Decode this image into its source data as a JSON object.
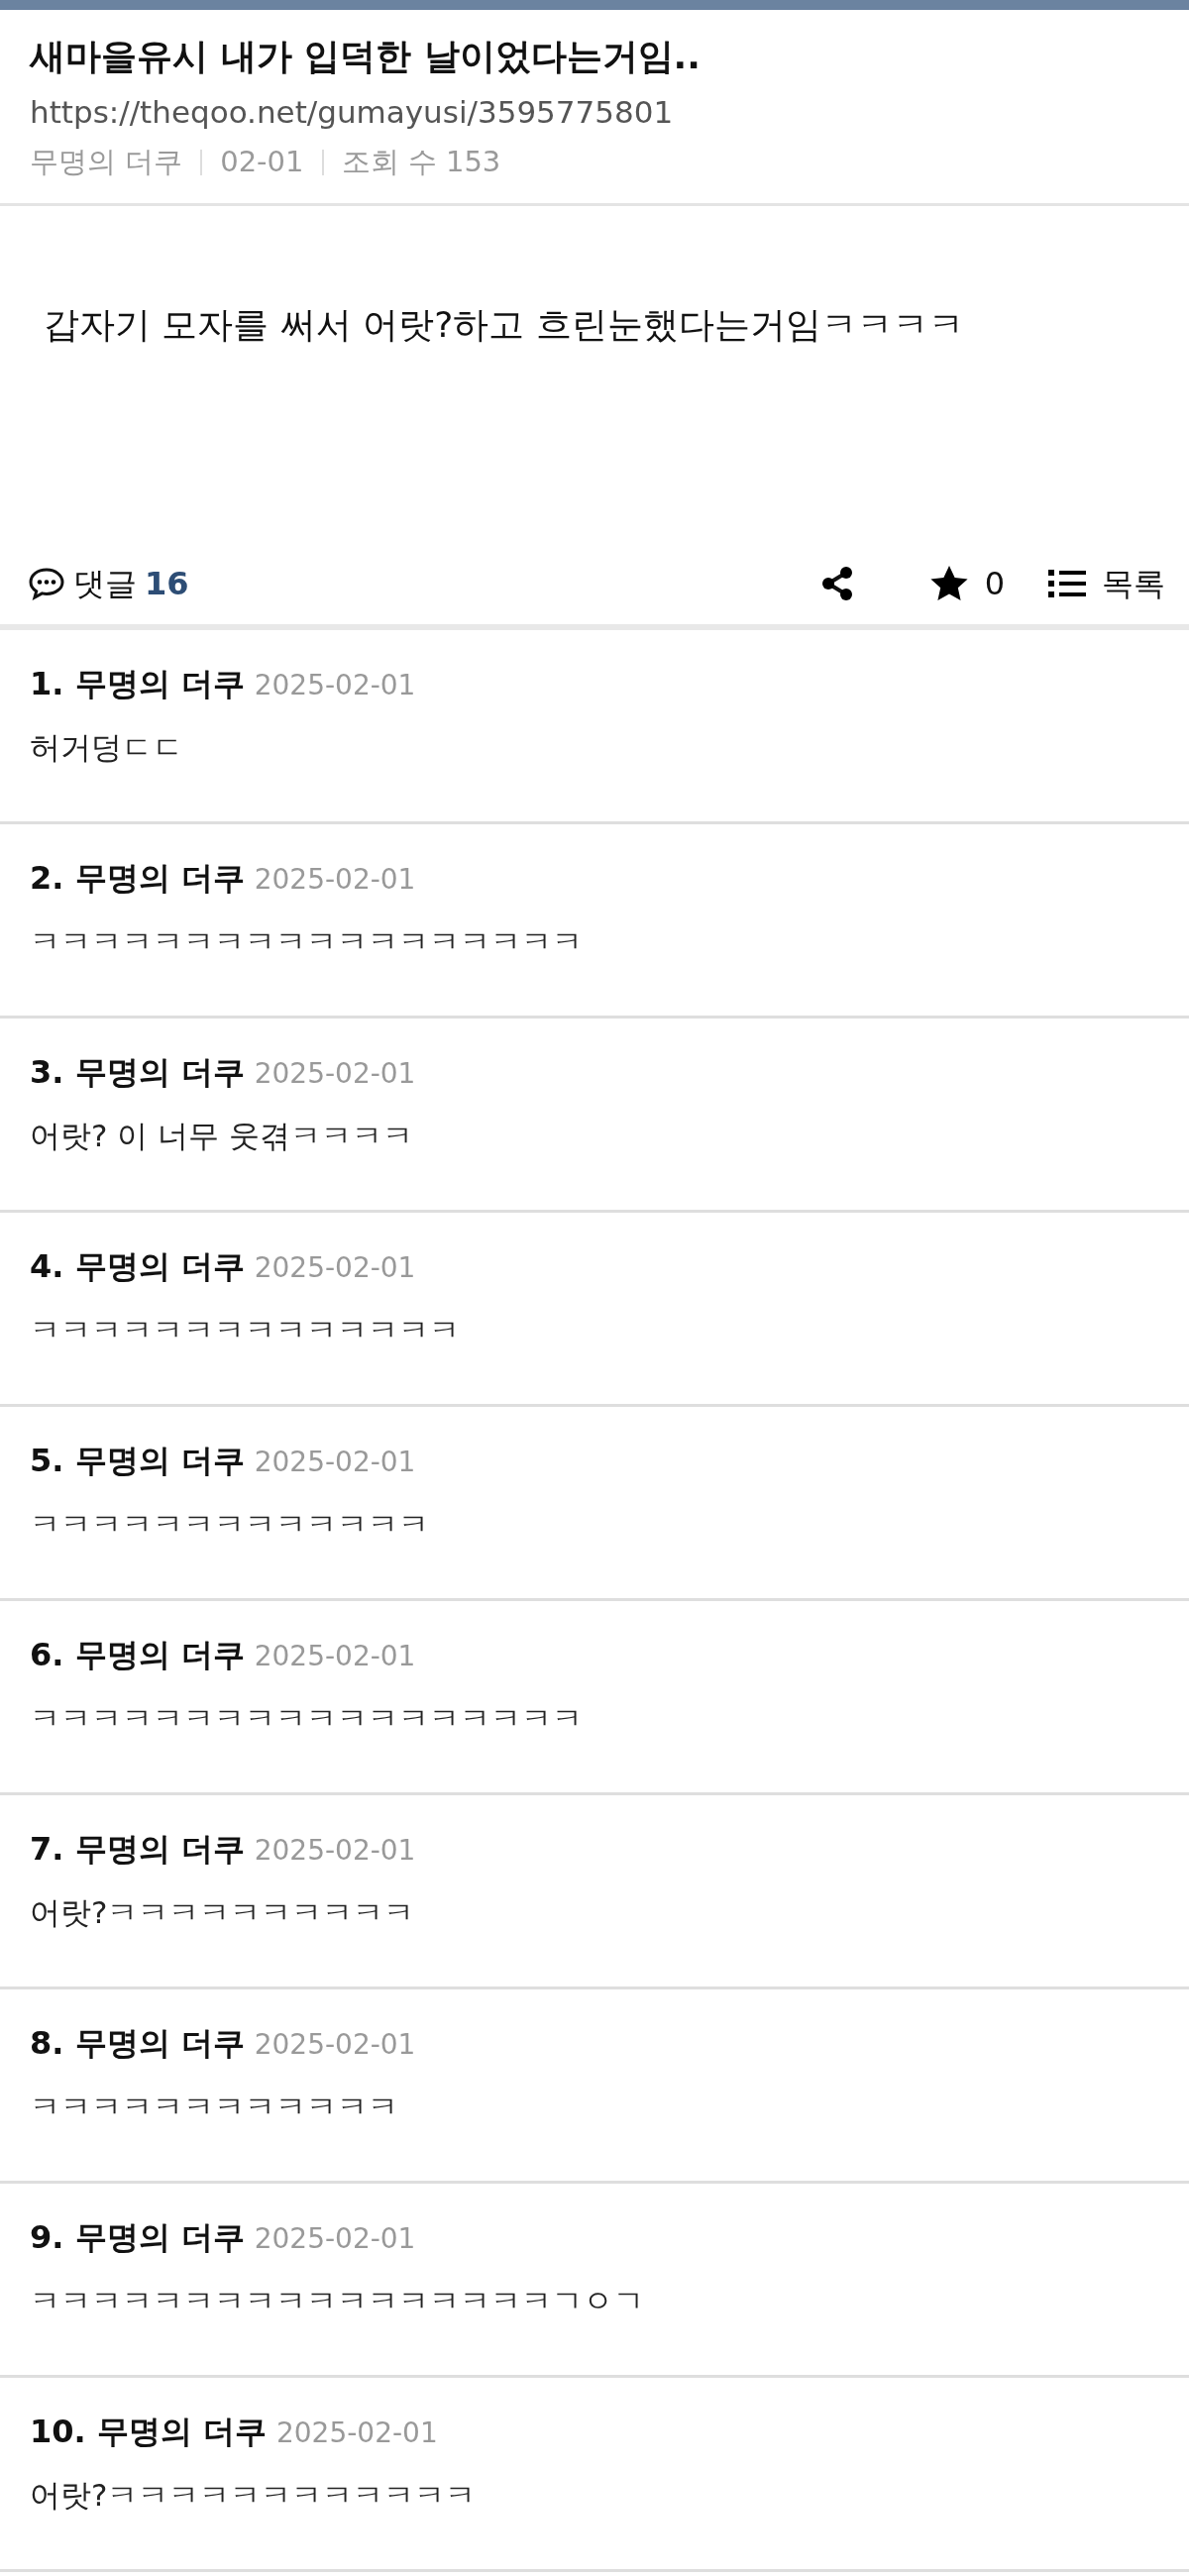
{
  "post": {
    "title": "새마을유시 내가 입덕한 날이었다는거임..",
    "url": "https://theqoo.net/gumayusi/3595775801",
    "author": "무명의 더쿠",
    "date": "02-01",
    "views": "조회 수 153"
  },
  "body": "갑자기 모자를 써서 어랏?하고 흐린눈했다는거임ㅋㅋㅋㅋ",
  "actions": {
    "comments_label": "댓글",
    "comments_count": "16",
    "star_count": "0",
    "list_label": "목록"
  },
  "comments": [
    {
      "header": "1. 무명의 더쿠",
      "date": "2025-02-01",
      "text": "허거덩ㄷㄷ"
    },
    {
      "header": "2. 무명의 더쿠",
      "date": "2025-02-01",
      "text": "ㅋㅋㅋㅋㅋㅋㅋㅋㅋㅋㅋㅋㅋㅋㅋㅋㅋㅋ"
    },
    {
      "header": "3. 무명의 더쿠",
      "date": "2025-02-01",
      "text": "어랏? 이 너무 웃겪ㅋㅋㅋㅋ"
    },
    {
      "header": "4. 무명의 더쿠",
      "date": "2025-02-01",
      "text": "ㅋㅋㅋㅋㅋㅋㅋㅋㅋㅋㅋㅋㅋㅋ"
    },
    {
      "header": "5. 무명의 더쿠",
      "date": "2025-02-01",
      "text": "ㅋㅋㅋㅋㅋㅋㅋㅋㅋㅋㅋㅋㅋ"
    },
    {
      "header": "6. 무명의 더쿠",
      "date": "2025-02-01",
      "text": "ㅋㅋㅋㅋㅋㅋㅋㅋㅋㅋㅋㅋㅋㅋㅋㅋㅋㅋ"
    },
    {
      "header": "7. 무명의 더쿠",
      "date": "2025-02-01",
      "text": "어랏?ㅋㅋㅋㅋㅋㅋㅋㅋㅋㅋ"
    },
    {
      "header": "8. 무명의 더쿠",
      "date": "2025-02-01",
      "text": "ㅋㅋㅋㅋㅋㅋㅋㅋㅋㅋㅋㅋ"
    },
    {
      "header": "9. 무명의 더쿠",
      "date": "2025-02-01",
      "text": "ㅋㅋㅋㅋㅋㅋㅋㅋㅋㅋㅋㅋㅋㅋㅋㅋㅋㄱㅇㄱ"
    },
    {
      "header": "10. 무명의 더쿠",
      "date": "2025-02-01",
      "text": "어랏?ㅋㅋㅋㅋㅋㅋㅋㅋㅋㅋㅋㅋ"
    }
  ]
}
